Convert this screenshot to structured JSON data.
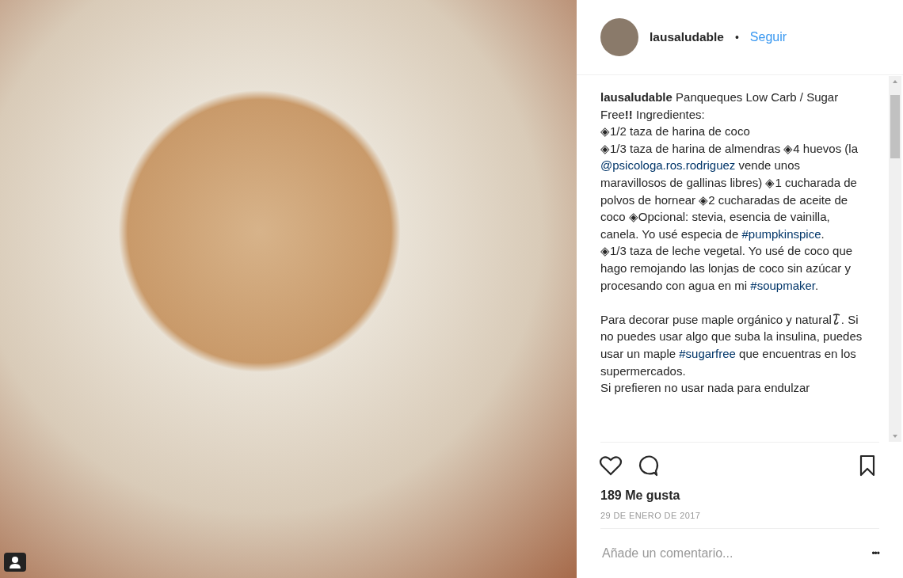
{
  "photo": {
    "has_tag_icon": true
  },
  "header": {
    "username": "lausaludable",
    "separator": "•",
    "follow": "Seguir"
  },
  "caption": [
    {
      "kind": "user",
      "text": "lausaludable"
    },
    {
      "kind": "text",
      "text": " Panqueques Low Carb / Sugar Free**!!** Ingredientes:\n◈1/2 taza de harina de coco\n◈1/3 taza de harina de almendras ◈4 huevos (la "
    },
    {
      "kind": "link",
      "text": "@psicologa.ros.rodriguez"
    },
    {
      "kind": "text",
      "text": " vende unos maravillosos de gallinas libres) ◈1 cucharada de polvos de hornear ◈2 cucharadas de aceite de coco ◈Opcional: stevia, esencia de vainilla, canela. Yo usé especia de "
    },
    {
      "kind": "link",
      "text": "#pumpkinspice"
    },
    {
      "kind": "text",
      "text": ".\n◈1/3 taza de leche vegetal. Yo usé de coco que hago remojando las lonjas de coco sin azúcar y procesando con agua en mi "
    },
    {
      "kind": "link",
      "text": "#soupmaker"
    },
    {
      "kind": "text",
      "text": ".\n\nPara decorar puse maple orgánico y natural"
    },
    {
      "kind": "icon"
    },
    {
      "kind": "text",
      "text": ". Si no puedes usar algo que suba la insulina, puedes usar un maple "
    },
    {
      "kind": "link",
      "text": "#sugarfree"
    },
    {
      "kind": "text",
      "text": " que encuentras en los supermercados.\nSi prefieren no usar nada para endulzar"
    }
  ],
  "actions": {
    "liked": false,
    "saved": false
  },
  "likes": "189 Me gusta",
  "date": "29 DE ENERO DE 2017",
  "comment": {
    "placeholder": "Añade un comentario...",
    "more": "•••"
  }
}
